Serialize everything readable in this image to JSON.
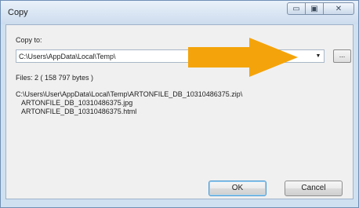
{
  "window": {
    "title": "Copy"
  },
  "caption": {
    "minimize": "▭",
    "maximize": "▣",
    "close": "✕"
  },
  "dialog": {
    "copy_to_label": "Copy to:",
    "destination_value": "C:\\Users\\AppData\\Local\\Temp\\",
    "browse_label": "...",
    "files_summary": "Files: 2   ( 158 797 bytes )",
    "files": [
      "C:\\Users\\User\\AppData\\Local\\Temp\\ARTONFILE_DB_10310486375.zip\\",
      "ARTONFILE_DB_10310486375.jpg",
      "ARTONFILE_DB_10310486375.html"
    ],
    "ok_label": "OK",
    "cancel_label": "Cancel"
  },
  "colors": {
    "annotation_arrow": "#f4a40a"
  },
  "icons": [
    "minimize-icon",
    "maximize-icon",
    "close-icon",
    "dropdown-arrow-icon",
    "orange-arrow-annotation"
  ]
}
